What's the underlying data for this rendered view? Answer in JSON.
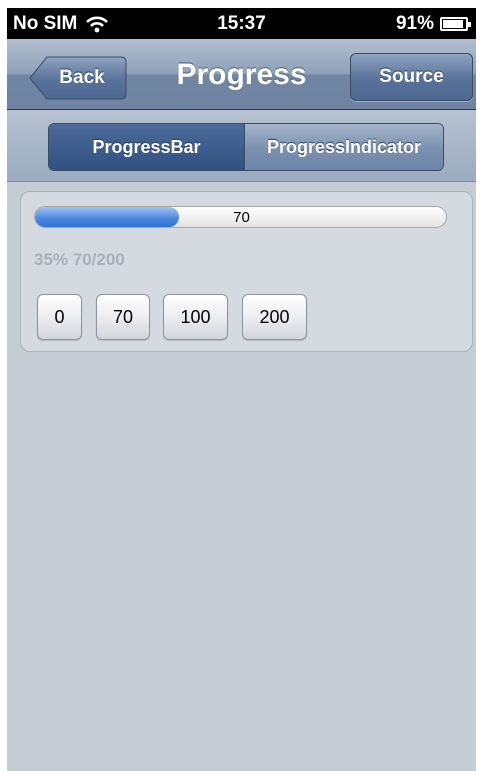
{
  "status_bar": {
    "carrier": "No SIM",
    "time": "15:37",
    "battery": "91%",
    "battery_level": 0.91
  },
  "nav_bar": {
    "title": "Progress",
    "back_label": "Back",
    "source_label": "Source"
  },
  "segmented_control": {
    "segments": [
      {
        "label": "ProgressBar",
        "selected": true
      },
      {
        "label": "ProgressIndicator",
        "selected": false
      }
    ]
  },
  "progress": {
    "value": 70,
    "max": 200,
    "fraction": 0.35,
    "bar_label": "70",
    "status_text": "35% 70/200"
  },
  "buttons": [
    {
      "label": "0"
    },
    {
      "label": "70"
    },
    {
      "label": "100"
    },
    {
      "label": "200"
    }
  ],
  "colors": {
    "nav_accent": "#6d83a1",
    "progress_fill": "#4f8be0",
    "background": "#c5ccd4"
  }
}
